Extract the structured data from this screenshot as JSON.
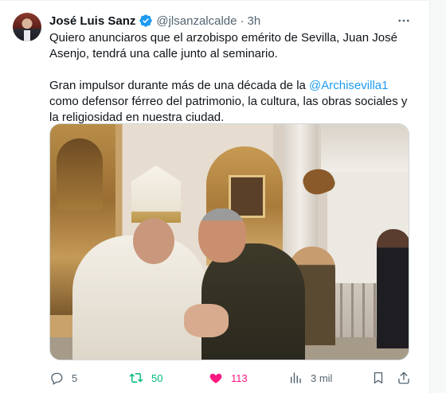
{
  "tweet": {
    "author_name": "José Luis Sanz",
    "handle": "@jlsanzalcalde",
    "separator": "·",
    "time": "3h",
    "more_label": "•••",
    "text_line1": "Quiero anunciaros que el arzobispo emérito de Sevilla, Juan José Asenjo, tendrá una calle junto al seminario.",
    "text_p2_before": "Gran impulsor durante más de una década de la ",
    "mention": "@Archisevilla1",
    "text_p2_after": " como defensor férreo del patrimonio, la cultura, las obras sociales y la religiosidad en nuestra ciudad."
  },
  "actions": {
    "replies": "5",
    "retweets": "50",
    "likes": "113",
    "views": "3 mil"
  },
  "colors": {
    "accent": "#1d9bf0",
    "retweet_active": "#00ba7c",
    "like_active": "#f91880",
    "muted": "#536471",
    "verified_badge": "#1d9bf0"
  },
  "icons": {
    "reply": "reply-icon",
    "retweet": "retweet-icon",
    "like": "heart-icon",
    "views": "views-icon",
    "bookmark": "bookmark-icon",
    "share": "share-icon",
    "verified": "verified-badge-icon",
    "more": "more-options-icon"
  }
}
